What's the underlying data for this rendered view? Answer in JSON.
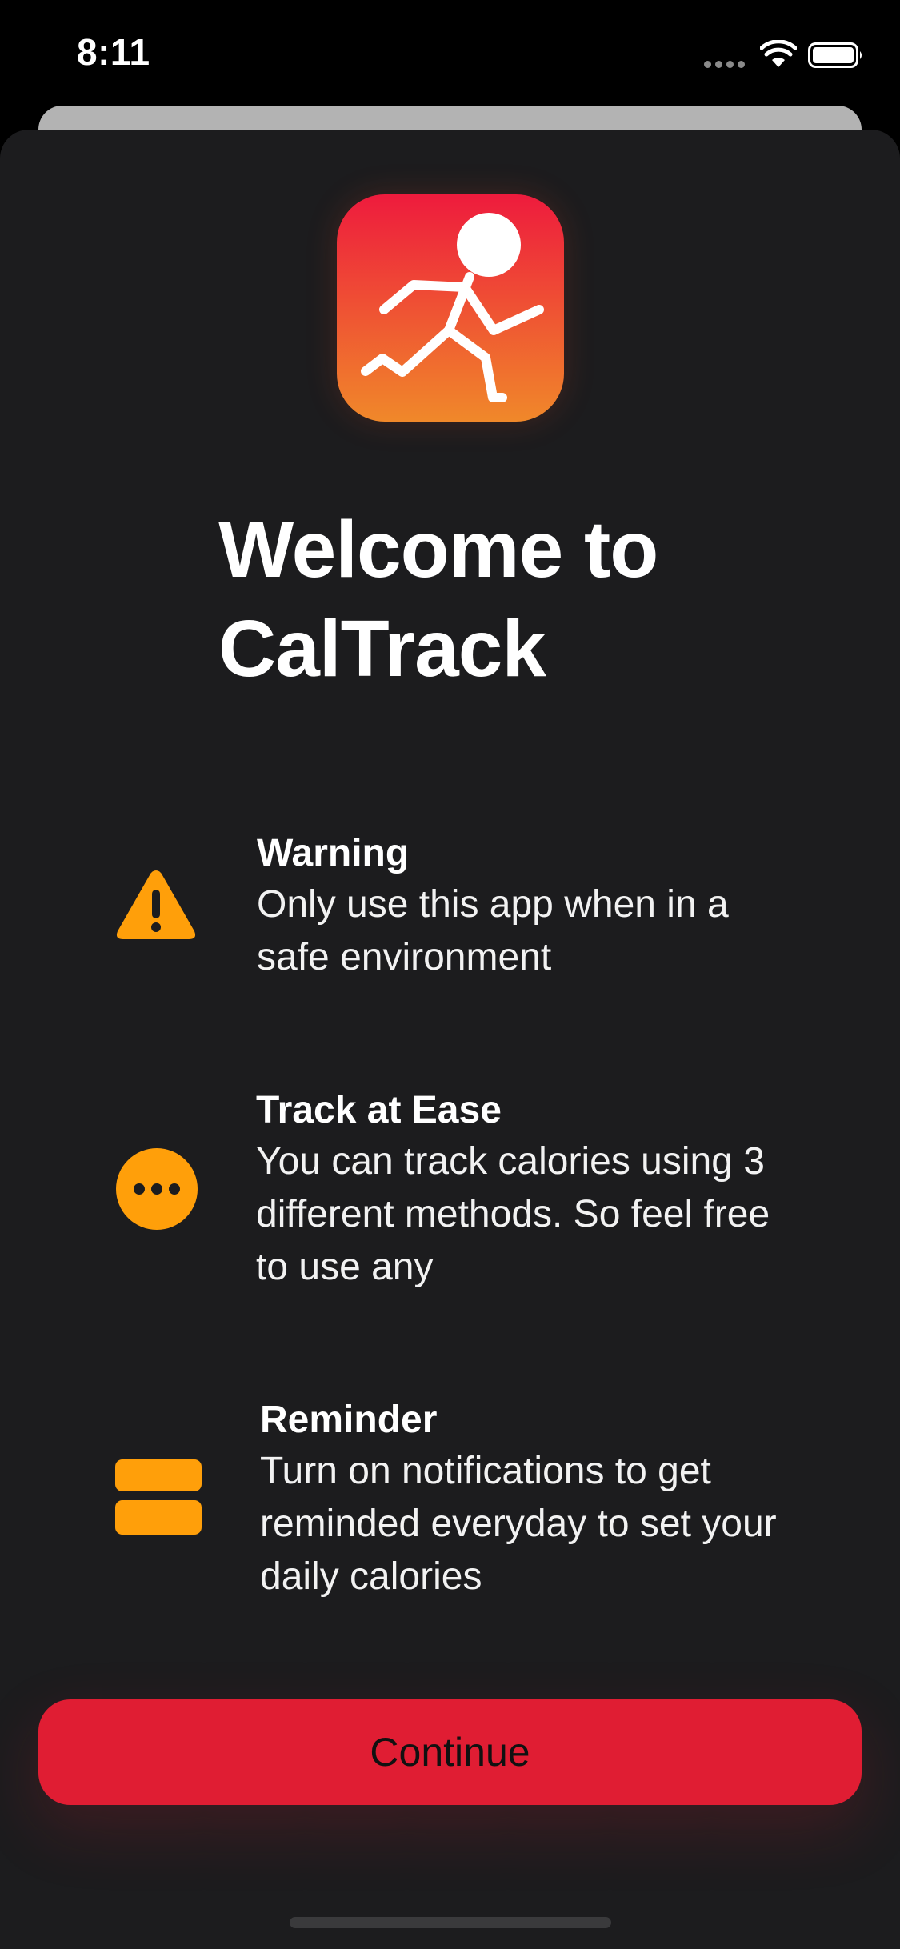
{
  "status_bar": {
    "time": "8:11",
    "wifi_icon": "wifi-icon",
    "battery_icon": "battery-icon",
    "signal_icon": "signal-dots-icon"
  },
  "app_icon": {
    "icon": "running-figure-icon",
    "gradient_top": "#ee1b3d",
    "gradient_bottom": "#f0882a"
  },
  "welcome": {
    "title_line1": "Welcome to",
    "title_line2": "CalTrack"
  },
  "features": [
    {
      "icon": "warning-triangle-icon",
      "title": "Warning",
      "desc_lines": [
        "Only use this app when in a",
        "safe environment"
      ]
    },
    {
      "icon": "ellipsis-circle-icon",
      "title": "Track at Ease",
      "desc_lines": [
        "You can track calories using 3",
        "different methods. So feel free",
        "to use any"
      ]
    },
    {
      "icon": "stacked-bars-icon",
      "title": "Reminder",
      "desc_lines": [
        "Turn on notifications to get",
        "reminded everyday to set your",
        "daily calories"
      ]
    }
  ],
  "continue_label": "Continue",
  "colors": {
    "accent": "#e01d33",
    "icon_orange": "#ff9f0a",
    "sheet_background": "#1c1c1e"
  }
}
